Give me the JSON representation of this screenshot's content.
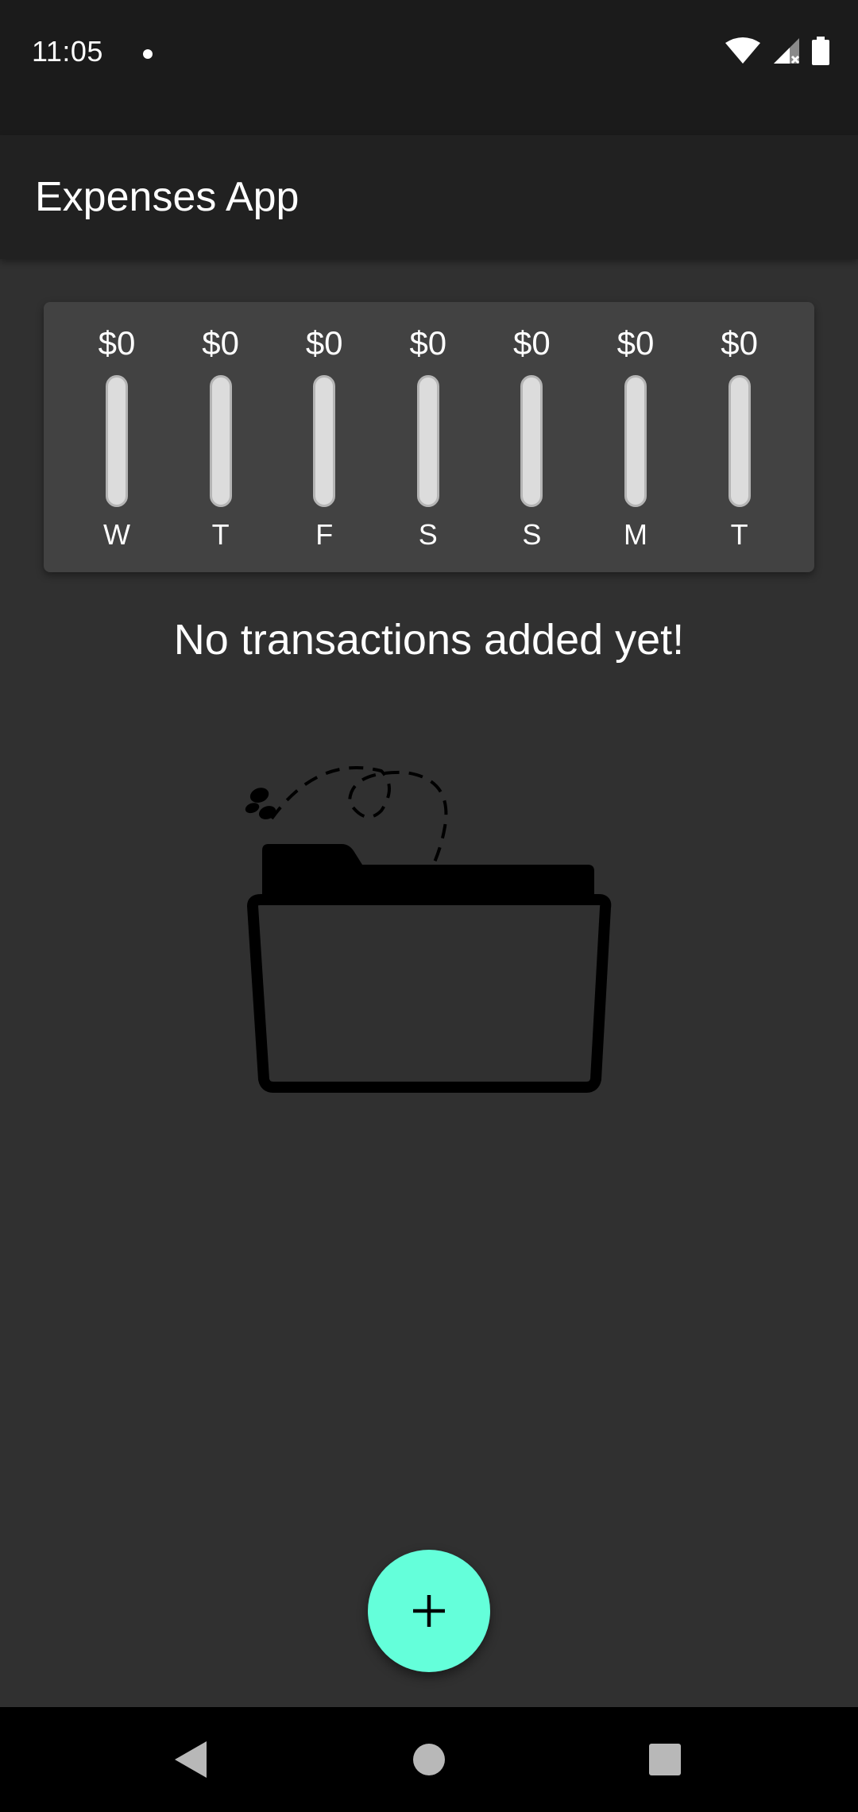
{
  "status_bar": {
    "time": "11:05",
    "icons": [
      "notification-dot-icon",
      "wifi-icon",
      "signal-icon",
      "battery-icon"
    ]
  },
  "app_bar": {
    "title": "Expenses App"
  },
  "chart_data": {
    "type": "bar",
    "categories": [
      "W",
      "T",
      "F",
      "S",
      "S",
      "M",
      "T"
    ],
    "labels": [
      "$0",
      "$0",
      "$0",
      "$0",
      "$0",
      "$0",
      "$0"
    ],
    "values": [
      0,
      0,
      0,
      0,
      0,
      0,
      0
    ],
    "fill_fraction": [
      0,
      0,
      0,
      0,
      0,
      0,
      0
    ]
  },
  "empty_state": {
    "message": "No transactions added yet!",
    "illustration": "empty-folder-butterfly-illustration"
  },
  "fab": {
    "icon": "plus-icon",
    "color": "#64ffda"
  },
  "nav_bar": {
    "icons": [
      "back-icon",
      "home-icon",
      "recents-icon"
    ]
  },
  "colors": {
    "background": "#303030",
    "app_bar": "#212121",
    "card": "#424242",
    "accent": "#64ffda"
  }
}
